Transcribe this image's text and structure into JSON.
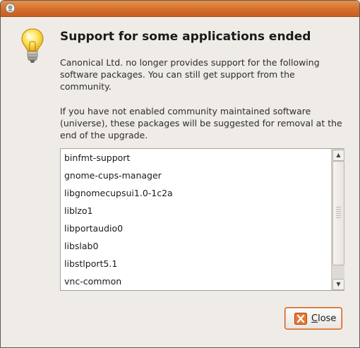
{
  "window": {
    "accent_color": "#d9712e",
    "title_icon": "dialog-app-icon"
  },
  "dialog": {
    "icon": "lightbulb-icon",
    "heading": "Support for some applications ended",
    "paragraph1": "Canonical Ltd. no longer provides support for the following software packages. You can still get support from the community.",
    "paragraph2": "If you have not enabled community maintained software (universe), these packages will be suggested for removal at the end of the upgrade."
  },
  "packages": [
    "binfmt-support",
    "gnome-cups-manager",
    "libgnomecupsui1.0-1c2a",
    "liblzo1",
    "libportaudio0",
    "libslab0",
    "libstlport5.1",
    "vnc-common"
  ],
  "close_button": {
    "mnemonic": "C",
    "label_rest": "lose",
    "icon": "close-icon",
    "accent_color": "#e0782e"
  }
}
